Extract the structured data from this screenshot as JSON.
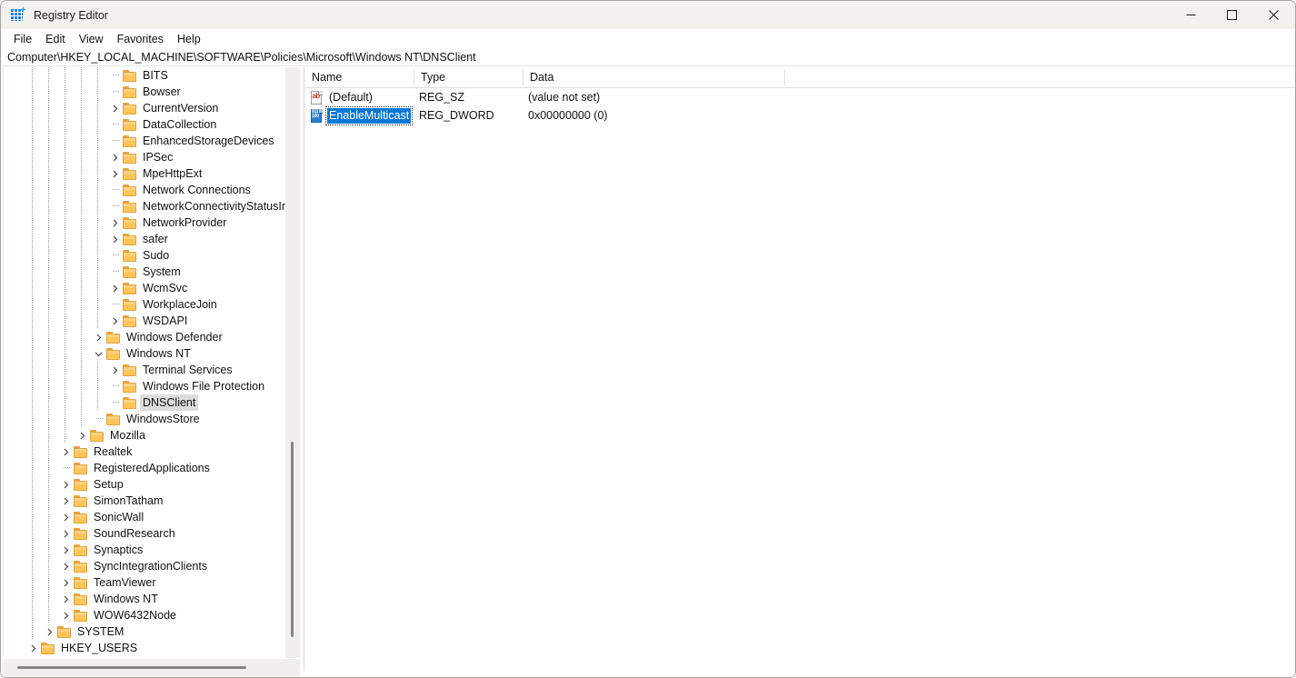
{
  "window": {
    "title": "Registry Editor",
    "icon": "registry-editor-icon",
    "controls": {
      "minimize": "minimize-icon",
      "maximize": "maximize-icon",
      "close": "close-icon"
    }
  },
  "menubar": {
    "items": [
      {
        "label": "File"
      },
      {
        "label": "Edit"
      },
      {
        "label": "View"
      },
      {
        "label": "Favorites"
      },
      {
        "label": "Help"
      }
    ]
  },
  "address": {
    "path": "Computer\\HKEY_LOCAL_MACHINE\\SOFTWARE\\Policies\\Microsoft\\Windows NT\\DNSClient"
  },
  "tree": {
    "rows": [
      {
        "label": "BITS",
        "depth": 5,
        "expander": "stub",
        "selected": false
      },
      {
        "label": "Bowser",
        "depth": 5,
        "expander": "stub",
        "selected": false
      },
      {
        "label": "CurrentVersion",
        "depth": 5,
        "expander": "collapsed",
        "selected": false
      },
      {
        "label": "DataCollection",
        "depth": 5,
        "expander": "stub",
        "selected": false
      },
      {
        "label": "EnhancedStorageDevices",
        "depth": 5,
        "expander": "stub",
        "selected": false
      },
      {
        "label": "IPSec",
        "depth": 5,
        "expander": "collapsed",
        "selected": false
      },
      {
        "label": "MpeHttpExt",
        "depth": 5,
        "expander": "collapsed",
        "selected": false
      },
      {
        "label": "Network Connections",
        "depth": 5,
        "expander": "stub",
        "selected": false
      },
      {
        "label": "NetworkConnectivityStatusIndicator",
        "depth": 5,
        "expander": "stub",
        "selected": false
      },
      {
        "label": "NetworkProvider",
        "depth": 5,
        "expander": "collapsed",
        "selected": false
      },
      {
        "label": "safer",
        "depth": 5,
        "expander": "collapsed",
        "selected": false
      },
      {
        "label": "Sudo",
        "depth": 5,
        "expander": "stub",
        "selected": false
      },
      {
        "label": "System",
        "depth": 5,
        "expander": "stub",
        "selected": false
      },
      {
        "label": "WcmSvc",
        "depth": 5,
        "expander": "collapsed",
        "selected": false
      },
      {
        "label": "WorkplaceJoin",
        "depth": 5,
        "expander": "stub",
        "selected": false
      },
      {
        "label": "WSDAPI",
        "depth": 5,
        "expander": "collapsed",
        "selected": false
      },
      {
        "label": "Windows Defender",
        "depth": 4,
        "expander": "collapsed",
        "selected": false
      },
      {
        "label": "Windows NT",
        "depth": 4,
        "expander": "expanded",
        "selected": false
      },
      {
        "label": "Terminal Services",
        "depth": 5,
        "expander": "collapsed",
        "selected": false
      },
      {
        "label": "Windows File Protection",
        "depth": 5,
        "expander": "stub",
        "selected": false
      },
      {
        "label": "DNSClient",
        "depth": 5,
        "expander": "stub",
        "selected": true
      },
      {
        "label": "WindowsStore",
        "depth": 4,
        "expander": "stub",
        "selected": false
      },
      {
        "label": "Mozilla",
        "depth": 3,
        "expander": "collapsed",
        "selected": false
      },
      {
        "label": "Realtek",
        "depth": 2,
        "expander": "collapsed",
        "selected": false
      },
      {
        "label": "RegisteredApplications",
        "depth": 2,
        "expander": "stub",
        "selected": false
      },
      {
        "label": "Setup",
        "depth": 2,
        "expander": "collapsed",
        "selected": false
      },
      {
        "label": "SimonTatham",
        "depth": 2,
        "expander": "collapsed",
        "selected": false
      },
      {
        "label": "SonicWall",
        "depth": 2,
        "expander": "collapsed",
        "selected": false
      },
      {
        "label": "SoundResearch",
        "depth": 2,
        "expander": "collapsed",
        "selected": false
      },
      {
        "label": "Synaptics",
        "depth": 2,
        "expander": "collapsed",
        "selected": false
      },
      {
        "label": "SyncIntegrationClients",
        "depth": 2,
        "expander": "collapsed",
        "selected": false
      },
      {
        "label": "TeamViewer",
        "depth": 2,
        "expander": "collapsed",
        "selected": false
      },
      {
        "label": "Windows NT",
        "depth": 2,
        "expander": "collapsed",
        "selected": false
      },
      {
        "label": "WOW6432Node",
        "depth": 2,
        "expander": "collapsed",
        "selected": false
      },
      {
        "label": "SYSTEM",
        "depth": 1,
        "expander": "collapsed",
        "selected": false
      },
      {
        "label": "HKEY_USERS",
        "depth": 0,
        "expander": "collapsed",
        "selected": false
      }
    ]
  },
  "list": {
    "columns": [
      {
        "label": "Name"
      },
      {
        "label": "Type"
      },
      {
        "label": "Data"
      }
    ],
    "rows": [
      {
        "icon": "string-value-icon",
        "name": "(Default)",
        "type": "REG_SZ",
        "data": "(value not set)",
        "selected": false
      },
      {
        "icon": "dword-value-icon",
        "name": "EnableMulticast",
        "type": "REG_DWORD",
        "data": "0x00000000 (0)",
        "selected": true
      }
    ]
  },
  "colors": {
    "selection_active": "#0a77d5",
    "selection_inactive": "#dcdcdc",
    "folder": "#ffc559",
    "titlebar": "#f3f1ee"
  }
}
